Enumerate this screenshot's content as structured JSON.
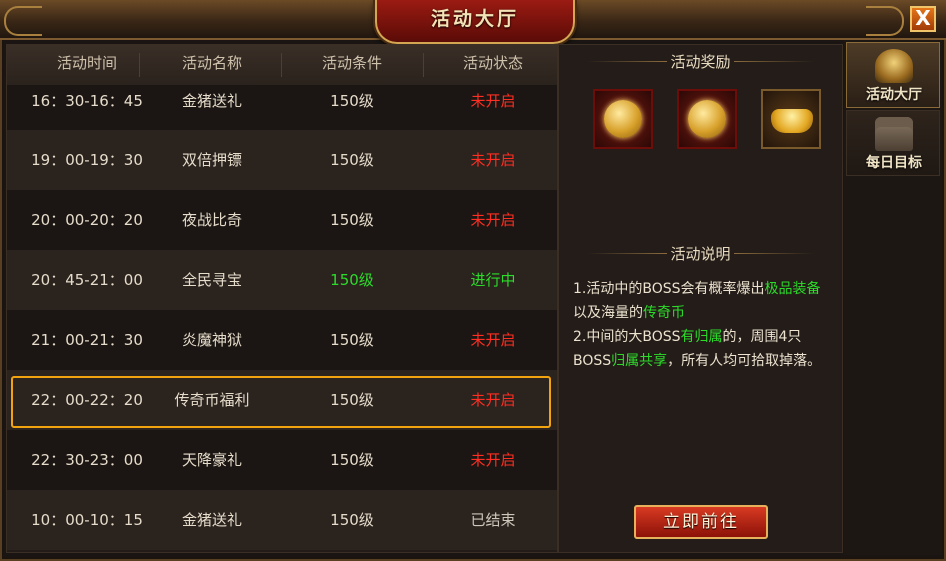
{
  "window": {
    "title": "活动大厅",
    "close_label": "X"
  },
  "table": {
    "headers": [
      "活动时间",
      "活动名称",
      "活动条件",
      "活动状态"
    ],
    "rows": [
      {
        "time": "16：30-16：45",
        "name": "金猪送礼",
        "level": "150级",
        "status": "未开启"
      },
      {
        "time": "19：00-19：30",
        "name": "双倍押镖",
        "level": "150级",
        "status": "未开启"
      },
      {
        "time": "20：00-20：20",
        "name": "夜战比奇",
        "level": "150级",
        "status": "未开启"
      },
      {
        "time": "20：45-21：00",
        "name": "全民寻宝",
        "level": "150级",
        "status": "进行中"
      },
      {
        "time": "21：00-21：30",
        "name": "炎魔神狱",
        "level": "150级",
        "status": "未开启"
      },
      {
        "time": "22：00-22：20",
        "name": "传奇币福利",
        "level": "150级",
        "status": "未开启"
      },
      {
        "time": "22：30-23：00",
        "name": "天降豪礼",
        "level": "150级",
        "status": "未开启"
      },
      {
        "time": "10：00-10：15",
        "name": "金猪送礼",
        "level": "150级",
        "status": "已结束"
      }
    ]
  },
  "rewards": {
    "title": "活动奖励",
    "items": [
      "gold-coin-icon",
      "gold-coin-icon",
      "gold-ingot-icon"
    ]
  },
  "description": {
    "title": "活动说明",
    "p1_a": "1.活动中的BOSS会有概率爆出",
    "p1_b": "极品装备",
    "p1_c": "以及海量的",
    "p1_d": "传奇币",
    "p2_a": "2.中间的大BOSS",
    "p2_b": "有归属",
    "p2_c": "的，周围4只BOSS",
    "p2_d": "归属共享",
    "p2_e": "，所有人均可拾取掉落。"
  },
  "go_button": "立即前往",
  "side_tabs": [
    {
      "label": "活动大厅"
    },
    {
      "label": "每日目标"
    }
  ],
  "colors": {
    "status_off": "#ff2e22",
    "status_on": "#2ddc2a",
    "highlight": "#f2a310"
  }
}
